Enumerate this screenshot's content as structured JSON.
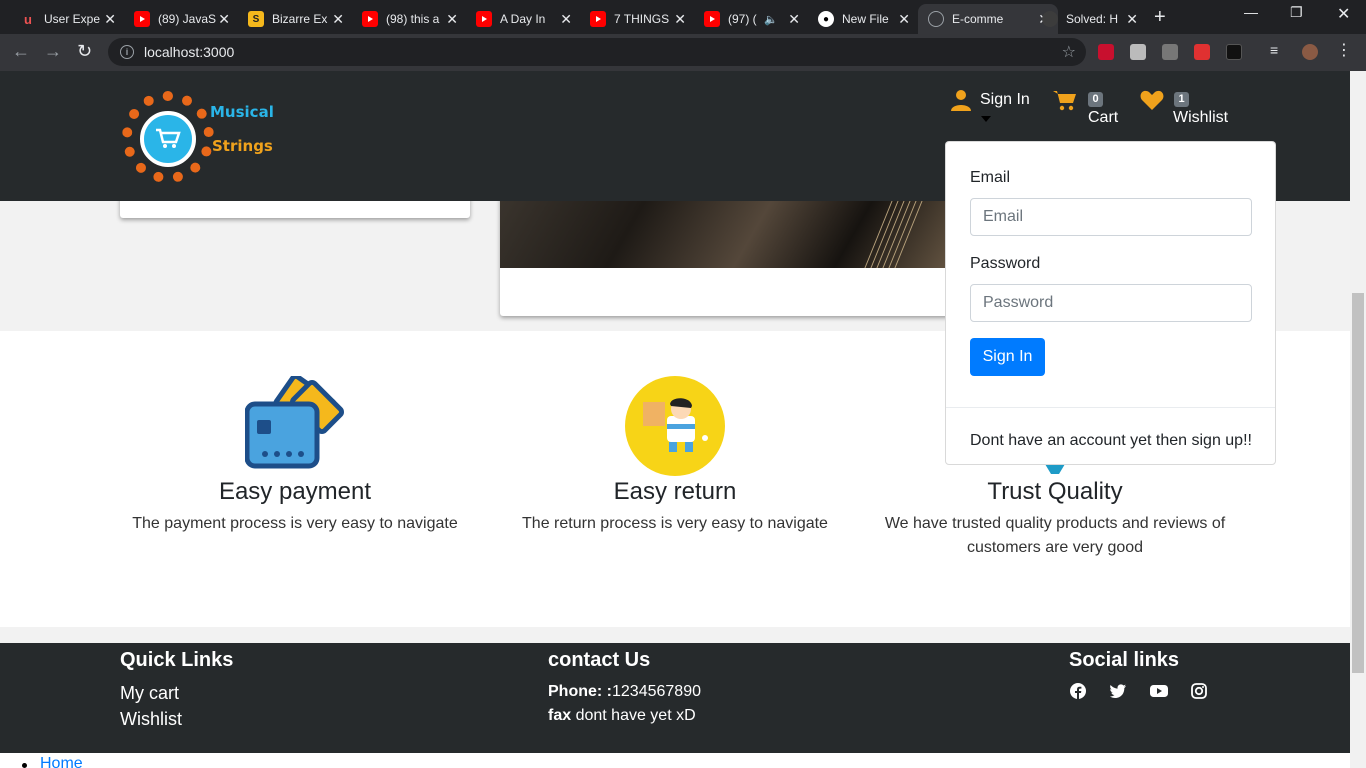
{
  "browser": {
    "tabs": [
      {
        "title": "User Expe",
        "icon": "udemy-icon"
      },
      {
        "title": "(89) JavaS",
        "icon": "youtube-icon"
      },
      {
        "title": "Bizarre Ex",
        "icon": "s-icon"
      },
      {
        "title": "(98) this a",
        "icon": "youtube-icon"
      },
      {
        "title": "A Day In",
        "icon": "youtube-icon"
      },
      {
        "title": "7 THINGS",
        "icon": "youtube-icon"
      },
      {
        "title": "(97) (",
        "icon": "youtube-icon"
      },
      {
        "title": "New File",
        "icon": "github-icon"
      },
      {
        "title": "E-comme",
        "icon": "globe-icon"
      },
      {
        "title": "Solved: H",
        "icon": "github-icon"
      }
    ],
    "url": "localhost:3000"
  },
  "logo": {
    "line1": "Musical",
    "line2": "Strings"
  },
  "nav": {
    "signin": "Sign In",
    "cart_label": "Cart",
    "cart_count": "0",
    "wishlist_label": "Wishlist",
    "wishlist_count": "1"
  },
  "signin_dropdown": {
    "email_label": "Email",
    "email_placeholder": "Email",
    "password_label": "Password",
    "password_placeholder": "Password",
    "button": "Sign In",
    "signup_text": "Dont have an account yet then sign up!!"
  },
  "features": [
    {
      "title": "Easy payment",
      "text": "The payment process is very easy to navigate",
      "icon": "wallet-icon"
    },
    {
      "title": "Easy return",
      "text": "The return process is very easy to navigate",
      "icon": "delivery-icon"
    },
    {
      "title": "Trust Quality",
      "text": "We have trusted quality products and reviews of customers are very good",
      "icon": "quality-icon"
    }
  ],
  "footer": {
    "quick_links_title": "Quick Links",
    "links": [
      "My cart",
      "Wishlist"
    ],
    "contact_title": "contact Us",
    "phone_label": "Phone: :",
    "phone": "1234567890",
    "fax_label": "fax",
    "fax": "dont have yet xD",
    "social_title": "Social links",
    "social": [
      "facebook-icon",
      "twitter-icon",
      "youtube-icon",
      "instagram-icon"
    ]
  },
  "breadcrumb_home": "Home",
  "colors": {
    "navbar": "#262a2c",
    "accent": "#f0a21c",
    "primary": "#007bff"
  }
}
